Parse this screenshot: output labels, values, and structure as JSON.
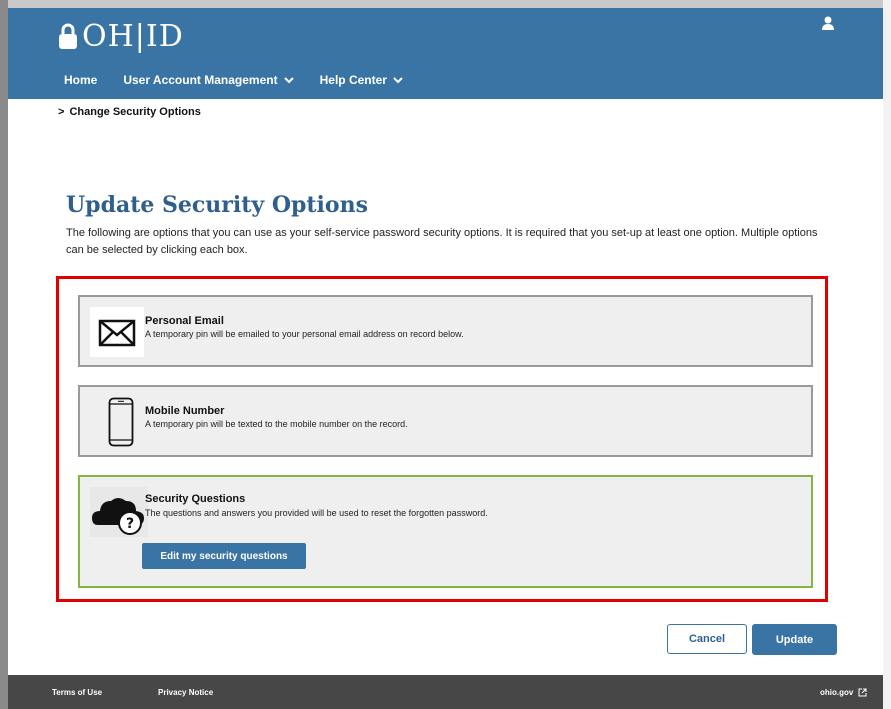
{
  "header": {
    "logo_text": "OH|ID",
    "nav": {
      "home": "Home",
      "user_account": "User Account Management",
      "help_center": "Help Center"
    }
  },
  "breadcrumb": {
    "current": "Change Security Options"
  },
  "main": {
    "title": "Update Security Options",
    "description": "The following are options that you can use as your self-service password security options. It is required that you set-up at least one option. Multiple options can be selected by clicking each box."
  },
  "options": {
    "email": {
      "title": "Personal Email",
      "desc": "A temporary pin will be emailed to your personal email address on record below.",
      "icon": "envelope-icon"
    },
    "mobile": {
      "title": "Mobile Number",
      "desc": "A temporary pin will be texted to the mobile number on the record.",
      "icon": "mobile-phone-icon"
    },
    "security": {
      "title": "Security Questions",
      "desc": "The questions and answers you provided will be used to reset the forgotten password.",
      "icon": "cloud-question-icon",
      "button": "Edit my security questions",
      "selected": true
    }
  },
  "actions": {
    "cancel": "Cancel",
    "update": "Update"
  },
  "footer": {
    "terms": "Terms of Use",
    "privacy": "Privacy Notice",
    "ohio": "ohio.gov"
  },
  "colors": {
    "header": "#3a74a5",
    "title": "#2f5f8e",
    "highlight": "#e00000",
    "selected_border": "#86b544",
    "footer": "#474747"
  }
}
